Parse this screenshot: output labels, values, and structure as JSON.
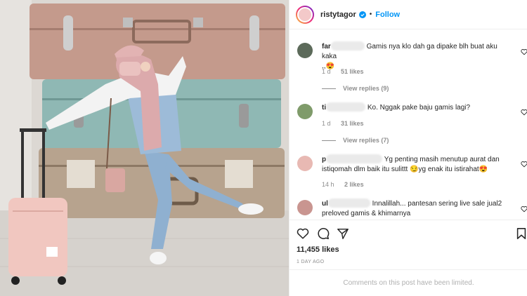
{
  "post": {
    "username": "ristytagor",
    "follow_label": "Follow",
    "separator": "•"
  },
  "comments": [
    {
      "name_visible": "far",
      "text": "Gamis nya klo dah ga dipake blh buat aku kaka",
      "text_line2": ",,😍",
      "time": "1 d",
      "likes": "51 likes",
      "replies": "View replies (9)"
    },
    {
      "name_visible": "ti",
      "text": "Ko. Nggak pake baju gamis lagi?",
      "time": "1 d",
      "likes": "31 likes",
      "replies": "View replies (7)"
    },
    {
      "name_visible": "p",
      "text": "Yg penting masih menutup aurat dan",
      "text_line2": "istiqomah dlm baik itu sulittt 😏yg enak itu istirahat😍",
      "time": "14 h",
      "likes": "2 likes"
    },
    {
      "name_visible": "ul",
      "text": "Innalillah... pantesan sering live sale jual2",
      "text_line2": "preloved gamis & khimarnya"
    }
  ],
  "likes_total": "11,455 likes",
  "time_ago": "1 DAY AGO",
  "limited_text": "Comments on this post have been limited.",
  "colors": {
    "accent": "#0095f6",
    "muted": "#8e8e8e"
  }
}
